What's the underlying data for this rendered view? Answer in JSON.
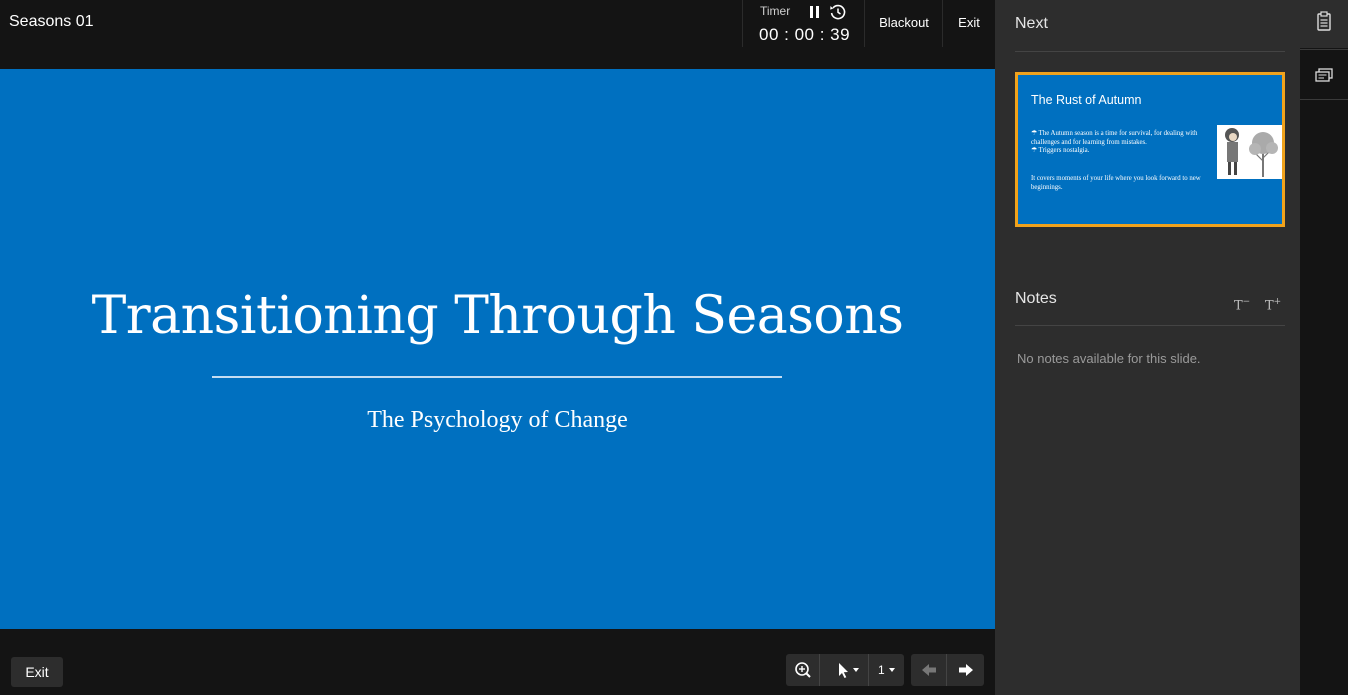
{
  "header": {
    "title": "Seasons 01",
    "timer_label": "Timer",
    "timer_value": "00 : 00 : 39",
    "blackout_label": "Blackout",
    "exit_label": "Exit"
  },
  "slide": {
    "title": "Transitioning Through Seasons",
    "subtitle": "The Psychology of Change",
    "background": "#0070c0"
  },
  "footer": {
    "exit_label": "Exit",
    "page_indicator": "1",
    "icons": [
      "zoom-in-icon",
      "pointer-icon",
      "arrow-left-icon",
      "arrow-right-icon"
    ]
  },
  "next_panel": {
    "heading": "Next",
    "thumb": {
      "title": "The Rust of Autumn",
      "bullet_1": "☂ The Autumn season is a time for survival, for dealing with challenges and for learning from mistakes.",
      "bullet_2": "☂ Triggers nostalgia.",
      "bullet_3": "It covers moments of your life where you look forward to new beginnings."
    },
    "highlight_color": "#f0a21c"
  },
  "notes_panel": {
    "heading": "Notes",
    "font_decrease": "T",
    "font_decrease_sign": "−",
    "font_increase": "T",
    "font_increase_sign": "+",
    "empty_text": "No notes available for this slide."
  },
  "rail": {
    "icons": [
      "notes-panel-icon",
      "slides-panel-icon"
    ]
  }
}
